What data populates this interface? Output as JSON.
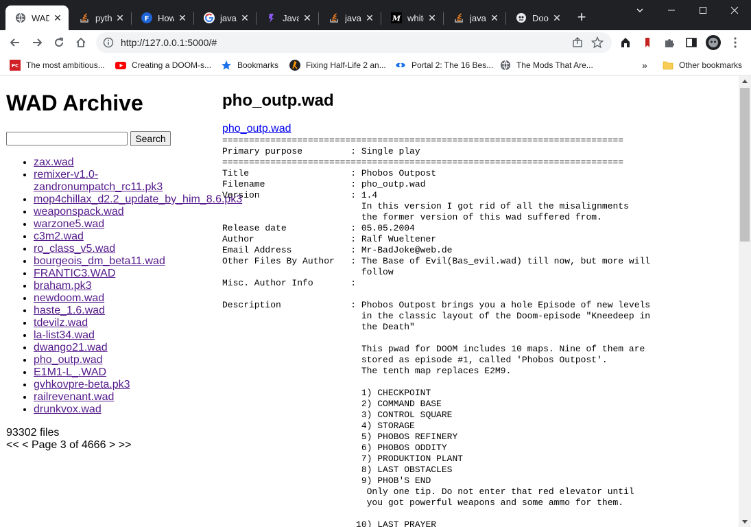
{
  "browser": {
    "tabs": [
      {
        "title": "WAD Archive",
        "icon": "globe-icon",
        "active": true
      },
      {
        "title": "python",
        "icon": "stackoverflow-icon"
      },
      {
        "title": "How",
        "icon": "freecodecamp-icon"
      },
      {
        "title": "javas",
        "icon": "google-icon"
      },
      {
        "title": "JavaS",
        "icon": "javascript-site-icon"
      },
      {
        "title": "javas",
        "icon": "stackoverflow-icon"
      },
      {
        "title": "white",
        "icon": "medium-icon"
      },
      {
        "title": "javas",
        "icon": "stackoverflow-icon"
      },
      {
        "title": "Doom",
        "icon": "doom-icon"
      }
    ],
    "new_tab_label": "+",
    "address": "http://127.0.0.1:5000/#",
    "bookmarks": [
      {
        "label": "The most ambitious...",
        "icon": "pcgamer-icon"
      },
      {
        "label": "Creating a DOOM-s...",
        "icon": "youtube-icon"
      },
      {
        "label": "Bookmarks",
        "icon": "star-icon"
      },
      {
        "label": "Fixing Half-Life 2 an...",
        "icon": "halflife-icon"
      },
      {
        "label": "Portal 2: The 16 Bes...",
        "icon": "portal-icon"
      },
      {
        "label": "The Mods That Are...",
        "icon": "globe-icon"
      }
    ],
    "bookmarks_overflow": "»",
    "other_bookmarks": "Other bookmarks"
  },
  "sidebar": {
    "title": "WAD Archive",
    "search_value": "",
    "search_button": "Search",
    "files": [
      "zax.wad",
      "remixer-v1.0-zandronumpatch_rc11.pk3",
      "mop4chillax_d2.2_update_by_him_8.6.pk3",
      "weaponspack.wad",
      "warzone5.wad",
      "c3m2.wad",
      "ro_class_v5.wad",
      "bourgeois_dm_beta11.wad",
      "FRANTIC3.WAD",
      "braham.pk3",
      "newdoom.wad",
      "haste_1.6.wad",
      "tdevilz.wad",
      "la-list34.wad",
      "dwango21.wad",
      "pho_outp.wad",
      "E1M1-L_.WAD",
      "gvhkovpre-beta.pk3",
      "railrevenant.wad",
      "drunkvox.wad"
    ],
    "file_count": "93302 files",
    "pager": {
      "first": "<<",
      "prev": "<",
      "status": "Page 3 of 4666",
      "next": ">",
      "last": ">>"
    }
  },
  "main": {
    "title": "pho_outp.wad",
    "link": "pho_outp.wad",
    "text": "===========================================================================\nPrimary purpose         : Single play\n===========================================================================\nTitle                   : Phobos Outpost\nFilename                : pho_outp.wad\nVersion                 : 1.4\n                          In this version I got rid of all the misalignments\n                          the former version of this wad suffered from.\nRelease date            : 05.05.2004\nAuthor                  : Ralf Wueltener\nEmail Address           : Mr-BadJoke@web.de\nOther Files By Author   : The Base of Evil(Bas_evil.wad) till now, but more will\n                          follow\nMisc. Author Info       :\n\nDescription             : Phobos Outpost brings you a hole Episode of new levels\n                          in the classic layout of the Doom-episode \"Kneedeep in\n                          the Death\"\n\n                          This pwad for DOOM includes 10 maps. Nine of them are\n                          stored as episode #1, called 'Phobos Outpost'.\n                          The tenth map replaces E2M9.\n\n                          1) CHECKPOINT\n                          2) COMMAND BASE\n                          3) CONTROL SQUARE\n                          4) STORAGE\n                          5) PHOBOS REFINERY\n                          6) PHOBOS ODDITY\n                          7) PRODUKTION PLANT\n                          8) LAST OBSTACLES\n                          9) PHOB'S END\n                           Only one tip. Do not enter that red elevator until\n                           you got powerful weapons and some ammo for them.\n\n                         10) LAST PRAYER"
  }
}
